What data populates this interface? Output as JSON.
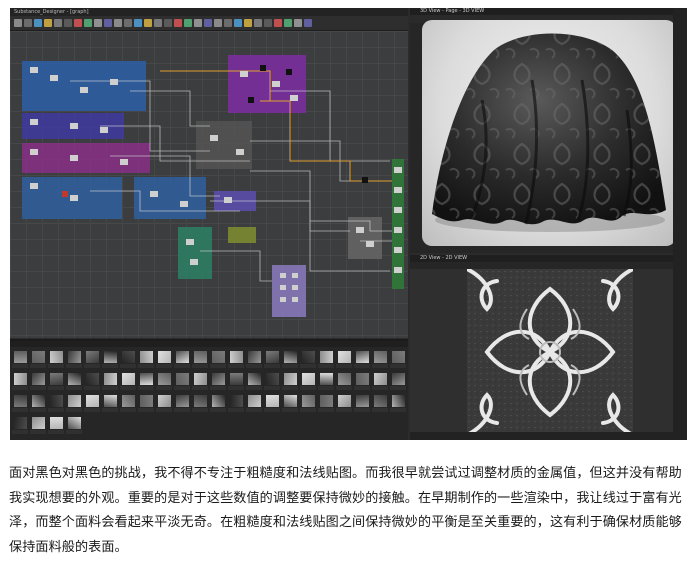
{
  "graph_window": {
    "title": "Substance_Designer - [graph]",
    "node_colors": [
      "#2b5fa8",
      "#6a2e9e",
      "#7a2c84",
      "#2d7a55",
      "#444444"
    ]
  },
  "viewer3d": {
    "title": "3D View - Page - 3D VIEW"
  },
  "viewer2d": {
    "title": "2D View - 2D VIEW"
  },
  "caption": {
    "text": "面对黑色对黑色的挑战，我不得不专注于粗糙度和法线贴图。而我很早就尝试过调整材质的金属值，但这并没有帮助我实现想要的外观。重要的是对于这些数值的调整要保持微妙的接触。在早期制作的一些渲染中，我让线过于富有光泽，而整个面料会看起来平淡无奇。在粗糙度和法线贴图之间保持微妙的平衡是至关重要的，这有利于确保材质能够保持面料般的表面。"
  }
}
